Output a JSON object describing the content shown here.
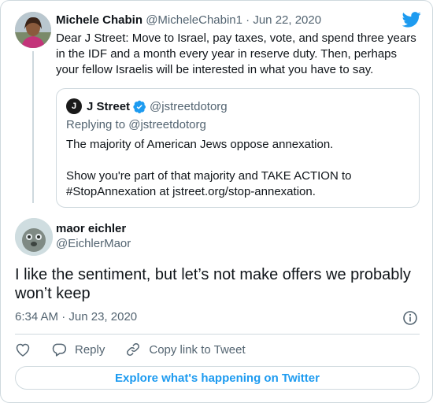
{
  "colors": {
    "accent": "#1d9bf0",
    "text": "#0f1419",
    "muted": "#536471",
    "border": "#cfd9de"
  },
  "parent_tweet": {
    "author_name": "Michele Chabin",
    "author_handle": "@MicheleChabin1",
    "separator": "·",
    "date": "Jun 22, 2020",
    "text": "Dear J Street: Move to Israel, pay taxes, vote, and spend three years in the IDF and a month every year in reserve duty. Then, perhaps your fellow Israelis will be interested in what you have to say.",
    "avatar_icon": "profile-photo",
    "quoted_tweet": {
      "avatar_label": "J",
      "author_name": "J Street",
      "author_handle": "@jstreetdotorg",
      "replying_to": "Replying to @jstreetdotorg",
      "text_line1": "The majority of American Jews oppose annexation.",
      "text_line2": "Show you're part of that majority and TAKE ACTION to #StopAnnexation at jstreet.org/stop-annexation."
    }
  },
  "reply_tweet": {
    "author_name": "maor eichler",
    "author_handle": "@EichlerMaor",
    "text": "I like the sentiment, but let’s not make offers we probably won’t keep",
    "time": "6:34 AM",
    "separator": "·",
    "date": "Jun 23, 2020"
  },
  "actions": {
    "like_icon": "heart-icon",
    "reply_label": "Reply",
    "copy_link_label": "Copy link to Tweet"
  },
  "explore_button": "Explore what's happening on Twitter"
}
